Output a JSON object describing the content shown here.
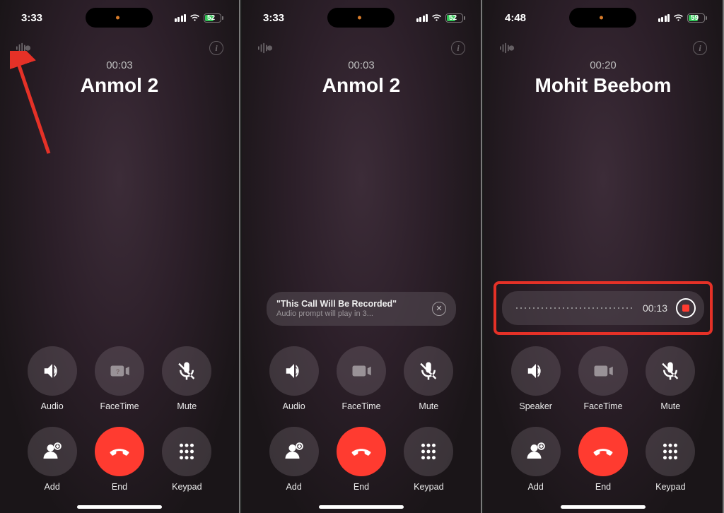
{
  "screens": [
    {
      "status": {
        "time": "3:33",
        "battery_pct": "52"
      },
      "call": {
        "duration": "00:03",
        "caller": "Anmol 2"
      },
      "show_arrow": true,
      "buttons": {
        "audio": "Audio",
        "facetime": "FaceTime",
        "mute": "Mute",
        "add": "Add",
        "end": "End",
        "keypad": "Keypad"
      }
    },
    {
      "status": {
        "time": "3:33",
        "battery_pct": "52"
      },
      "call": {
        "duration": "00:03",
        "caller": "Anmol 2"
      },
      "prompt": {
        "title": "\"This Call Will Be Recorded\"",
        "sub": "Audio prompt will play in 3..."
      },
      "buttons": {
        "audio": "Audio",
        "facetime": "FaceTime",
        "mute": "Mute",
        "add": "Add",
        "end": "End",
        "keypad": "Keypad"
      }
    },
    {
      "status": {
        "time": "4:48",
        "battery_pct": "59"
      },
      "call": {
        "duration": "00:20",
        "caller": "Mohit Beebom"
      },
      "recording": {
        "elapsed": "00:13"
      },
      "buttons": {
        "audio": "Speaker",
        "facetime": "FaceTime",
        "mute": "Mute",
        "add": "Add",
        "end": "End",
        "keypad": "Keypad"
      }
    }
  ],
  "colors": {
    "end_red": "#ff3b30",
    "annotation_red": "#e53127",
    "battery_green": "#34c759"
  }
}
